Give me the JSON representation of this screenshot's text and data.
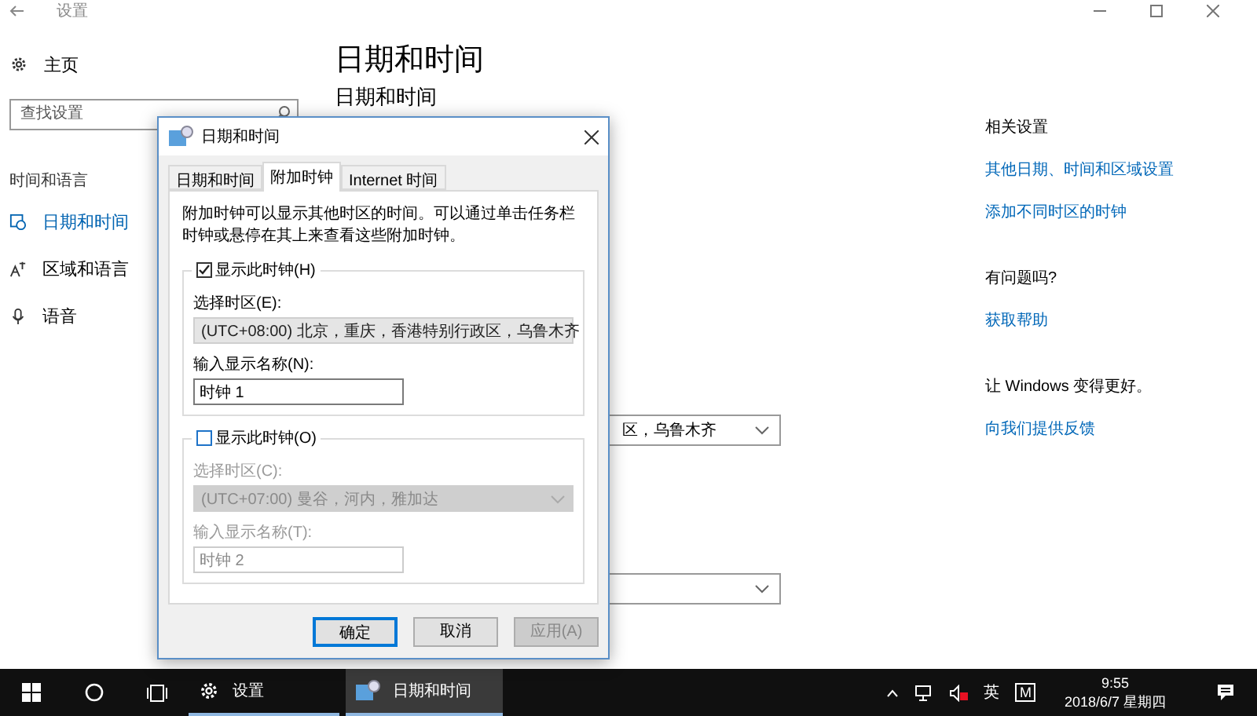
{
  "settings_window": {
    "title": "设置",
    "sidebar": {
      "home": "主页",
      "search": {
        "placeholder": "查找设置"
      },
      "section": "时间和语言",
      "items": [
        {
          "label": "日期和时间",
          "selected": true,
          "kind": "clock"
        },
        {
          "label": "区域和语言",
          "selected": false,
          "kind": "region"
        },
        {
          "label": "语音",
          "selected": false,
          "kind": "speech"
        }
      ]
    },
    "main": {
      "title": "日期和时间",
      "subtitle": "日期和时间",
      "dropdowns": [
        {
          "kind": "dropdown",
          "value": "区，乌鲁木齐"
        },
        {
          "kind": "dropdown"
        }
      ]
    },
    "related": [
      {
        "heading": "相关设置",
        "links": [
          "其他日期、时间和区域设置",
          "添加不同时区的时钟"
        ]
      },
      {
        "heading": "有问题吗?",
        "links": [
          "获取帮助"
        ]
      },
      {
        "heading": "让 Windows 变得更好。",
        "links": [
          "向我们提供反馈"
        ]
      }
    ]
  },
  "dialog": {
    "title": "日期和时间",
    "tabs": [
      {
        "label": "日期和时间",
        "selected": false
      },
      {
        "label": "附加时钟",
        "selected": true
      },
      {
        "label": "Internet 时间",
        "selected": false
      }
    ],
    "description": "附加时钟可以显示其他时区的时间。可以通过单击任务栏时钟或悬停在其上来查看这些附加时钟。",
    "clocks": [
      {
        "show_label": "显示此时钟(H)",
        "checked": true,
        "timezone_label": "选择时区(E):",
        "timezone": "(UTC+08:00) 北京，重庆，香港特别行政区，乌鲁木齐",
        "name_label": "输入显示名称(N):",
        "name": "时钟 1"
      },
      {
        "show_label": "显示此时钟(O)",
        "checked": false,
        "timezone_label": "选择时区(C):",
        "timezone": "(UTC+07:00) 曼谷，河内，雅加达",
        "name_label": "输入显示名称(T):",
        "name": "时钟 2"
      }
    ],
    "buttons": [
      {
        "label": "确定",
        "default": true,
        "disabled": false
      },
      {
        "label": "取消",
        "default": false,
        "disabled": false
      },
      {
        "label": "应用(A)",
        "default": false,
        "disabled": true
      }
    ]
  },
  "taskbar": {
    "apps": [
      {
        "label": "设置",
        "kind": "settings",
        "selected": false
      },
      {
        "label": "日期和时间",
        "kind": "datetime",
        "selected": true
      }
    ],
    "ime": "英",
    "ime_mode": "M",
    "time": "9:55",
    "date": "2018/6/7 星期四"
  }
}
